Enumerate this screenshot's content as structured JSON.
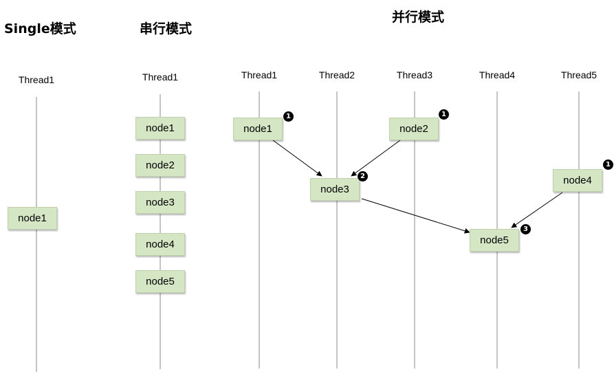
{
  "sections": {
    "single": {
      "title": "Single模式",
      "threads": [
        "Thread1"
      ],
      "nodes": [
        "node1"
      ]
    },
    "serial": {
      "title": "串行模式",
      "threads": [
        "Thread1"
      ],
      "nodes": [
        "node1",
        "node2",
        "node3",
        "node4",
        "node5"
      ]
    },
    "parallel": {
      "title": "并行模式",
      "threads": [
        "Thread1",
        "Thread2",
        "Thread3",
        "Thread4",
        "Thread5"
      ],
      "nodes": [
        {
          "label": "node1",
          "thread": "Thread1",
          "step": "1"
        },
        {
          "label": "node2",
          "thread": "Thread3",
          "step": "1"
        },
        {
          "label": "node3",
          "thread": "Thread2",
          "step": "2"
        },
        {
          "label": "node4",
          "thread": "Thread5",
          "step": "1"
        },
        {
          "label": "node5",
          "thread": "Thread4",
          "step": "3"
        }
      ],
      "edges": [
        {
          "from": "node1",
          "to": "node3"
        },
        {
          "from": "node2",
          "to": "node3"
        },
        {
          "from": "node3",
          "to": "node5"
        },
        {
          "from": "node4",
          "to": "node5"
        }
      ]
    }
  },
  "colors": {
    "node_fill": "#d4e6c4",
    "lane": "#c4c4c4",
    "badge": "#000000"
  }
}
